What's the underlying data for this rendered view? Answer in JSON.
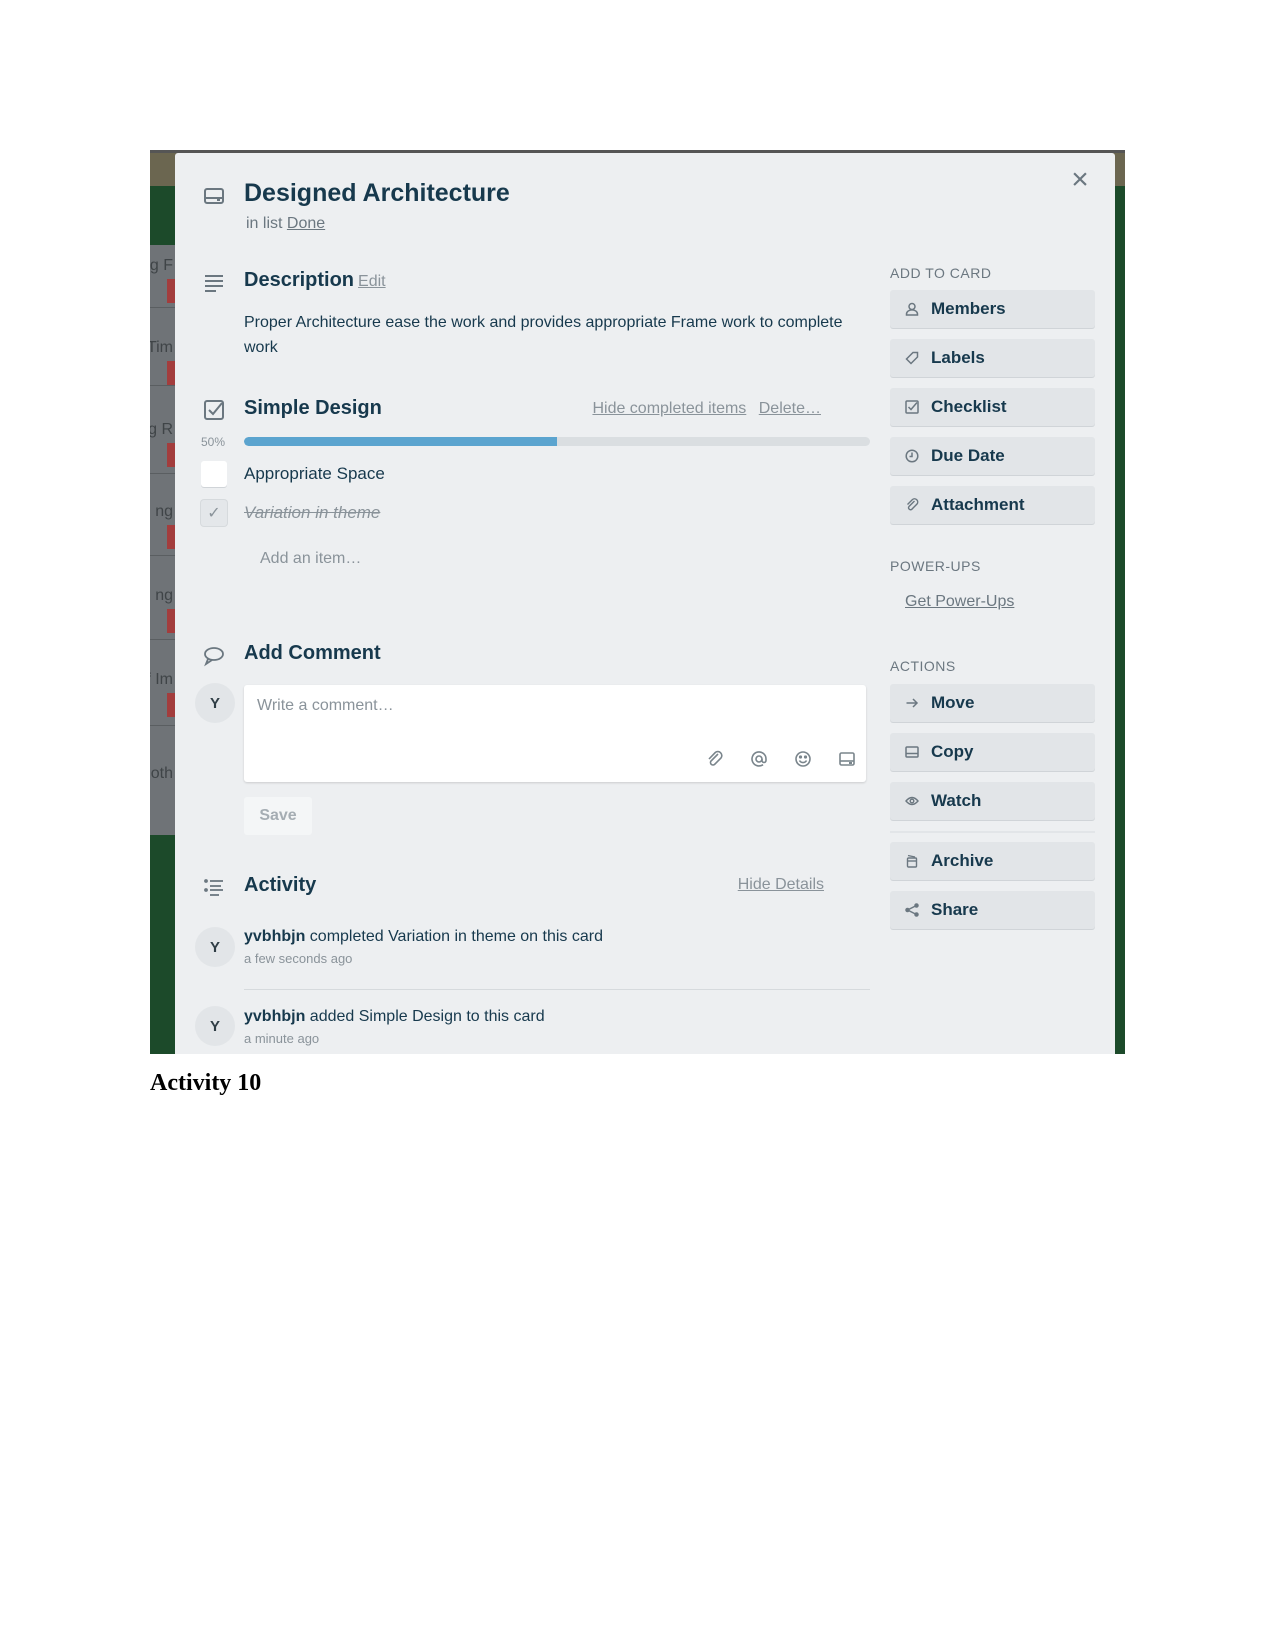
{
  "background_board": {
    "ghost_cards": [
      {
        "text": "ng F"
      },
      {
        "text": "Tim"
      },
      {
        "text": "ng R"
      },
      {
        "text": "ng ."
      },
      {
        "text": "ng ("
      },
      {
        "text": "f Im"
      },
      {
        "text": "noth"
      }
    ]
  },
  "card": {
    "title": "Designed Architecture",
    "in_list_prefix": "in list",
    "list_name": "Done",
    "close_label": "×"
  },
  "description": {
    "heading": "Description",
    "edit_label": "Edit",
    "text": "Proper Architecture ease the work and provides appropriate Frame work to complete work"
  },
  "checklist": {
    "title": "Simple Design",
    "hide_completed_label": "Hide completed items",
    "delete_label": "Delete…",
    "progress_percent": 50,
    "progress_label": "50%",
    "items": [
      {
        "label": "Appropriate Space",
        "checked": false
      },
      {
        "label": "Variation in theme",
        "checked": true
      }
    ],
    "add_item_label": "Add an item…"
  },
  "comment": {
    "heading": "Add Comment",
    "avatar_initial": "Y",
    "placeholder": "Write a comment…",
    "value": "",
    "tools": [
      "attachment-icon",
      "mention-icon",
      "emoji-icon",
      "card-icon"
    ],
    "save_label": "Save"
  },
  "activity": {
    "heading": "Activity",
    "hide_details_label": "Hide Details",
    "items": [
      {
        "avatar_initial": "Y",
        "user": "yvbhbjn",
        "action": "completed Variation in theme on this card",
        "time": "a few seconds ago"
      },
      {
        "avatar_initial": "Y",
        "user": "yvbhbjn",
        "action": "added Simple Design to this card",
        "time": "a minute ago"
      }
    ]
  },
  "sidebar": {
    "add_to_card_heading": "ADD TO CARD",
    "add_to_card": [
      {
        "label": "Members",
        "icon": "member-icon"
      },
      {
        "label": "Labels",
        "icon": "label-icon"
      },
      {
        "label": "Checklist",
        "icon": "checklist-icon"
      },
      {
        "label": "Due Date",
        "icon": "clock-icon"
      },
      {
        "label": "Attachment",
        "icon": "attachment-icon"
      }
    ],
    "power_ups_heading": "POWER-UPS",
    "get_power_ups_label": "Get Power-Ups",
    "actions_heading": "ACTIONS",
    "actions": [
      {
        "label": "Move",
        "icon": "arrow-right-icon"
      },
      {
        "label": "Copy",
        "icon": "card-icon"
      },
      {
        "label": "Watch",
        "icon": "eye-icon"
      },
      {
        "label": "Archive",
        "icon": "archive-icon"
      },
      {
        "label": "Share",
        "icon": "share-icon"
      }
    ]
  },
  "colors": {
    "progress_fill": "#5ba4cf",
    "board_background": "#1c4a2a",
    "modal_background": "#edeff1",
    "title_text": "#17394d"
  },
  "document_caption": "Activity 10"
}
